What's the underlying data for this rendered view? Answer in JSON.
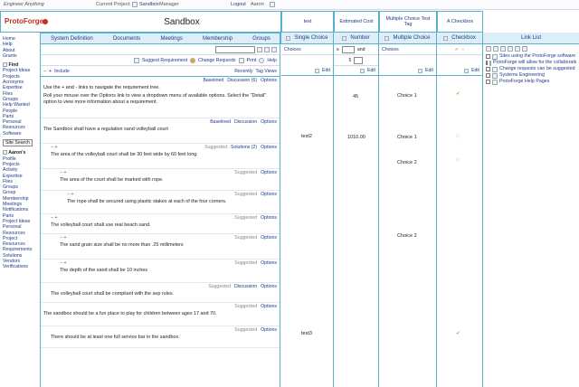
{
  "topbar": {
    "app": "Engineer Anything",
    "current_project_label": "Current Project:",
    "project_link": "Sandbox",
    "role": "Manager",
    "logout": "Logout",
    "user": "Aaron"
  },
  "logo": {
    "text": "ProtoForge"
  },
  "title": "Sandbox",
  "column_headers": {
    "text": "text",
    "estimated_cost": "Estimated Cost",
    "mc_tag": "Multiple Choice Test Tag",
    "checkbox": "A Checkbox"
  },
  "tabs": [
    "System Definition",
    "Documents",
    "Meetings",
    "Membership",
    "Groups"
  ],
  "sidebar": {
    "top_links": [
      "Home",
      "Help",
      "About",
      "Grants"
    ],
    "find_title": "Find",
    "find_links": [
      "Project Ideas",
      "Projects",
      "Acronyms",
      "Expertise",
      "Files",
      "Groups",
      "Help Wanted",
      "People",
      "Parts",
      "Personal",
      "Resources",
      "Software"
    ],
    "site_search": "Site Search",
    "user_title": "Aaron's",
    "user_links": [
      "Profile",
      "Projects",
      "Activity",
      "Expertise",
      "Files",
      "Groups",
      "Group Membership",
      "Meetings",
      "Notifications",
      "Parts",
      "Project Ideas",
      "Personal Resources",
      "Project Resources",
      "Requirements",
      "Solutions",
      "Vendors",
      "Verifications"
    ]
  },
  "main_controls": {
    "suggest": "Suggest Requirement",
    "change": "Change Requests",
    "print": "Print",
    "help": "Help",
    "include": "Include",
    "recently": "Recently",
    "tag_views": "Tag Views"
  },
  "intro": {
    "baselined": "Baselined",
    "discussion": "Discussion (6)",
    "options": "Options",
    "line1": "Use the + and - links to navigate the requirement tree.",
    "line2": "Roll your mouse over the Options link to view a dropdown menu of available options. Select the \"Detail\" option to view more information about a requirement."
  },
  "requirements": [
    {
      "meta": [
        "Baselined",
        "Discussion",
        "Options"
      ],
      "text": "The Sandbox shall have a regulation sand volleyball court"
    },
    {
      "meta": [
        "Suggested",
        "Solutions (2)",
        "Options"
      ],
      "text": "The area of the volleyball court shall be 30 feet wide by 60 feet long."
    },
    {
      "meta": [
        "Suggested",
        "Options"
      ],
      "text": "The area of the court shall be marked with rope."
    },
    {
      "meta": [
        "Suggested",
        "Options"
      ],
      "text": "The rope shall be secured using plastic stakes at each of the four corners."
    },
    {
      "meta": [
        "Suggested",
        "Options"
      ],
      "text": "The volleyball court shall use real beach sand."
    },
    {
      "meta": [
        "Suggested",
        "Options"
      ],
      "text": "The sand grain size shall be no more than .25 millimeters"
    },
    {
      "meta": [
        "Suggested",
        "Options"
      ],
      "text": "The depth of the sand shall be 10 inches"
    },
    {
      "meta": [
        "Suggested",
        "Discussion",
        "Options"
      ],
      "text": "The volleyball court shall be compliant with the avp rules."
    },
    {
      "meta": [
        "Suggested",
        "Options"
      ],
      "text": "The sandbox should be a fun place to play for children between ages 17 and 70."
    },
    {
      "meta": [
        "Suggested",
        "Options"
      ],
      "text": "There should be at least one full service bar in the sandbox."
    }
  ],
  "col_single": {
    "title": "Single Choice",
    "choices": "Choices",
    "edit": "Edit",
    "values": [
      "test2",
      "test3"
    ]
  },
  "col_number": {
    "title": "Number",
    "and": "and",
    "five": "5",
    "edit": "Edit",
    "values": [
      "45",
      "1010.00"
    ]
  },
  "col_multi": {
    "title": "Multiple Choice",
    "choices": "Choices",
    "edit": "Edit",
    "values": [
      "Choice 1",
      "Choice 1",
      "Choice 2",
      "Choice 2"
    ]
  },
  "col_checkbox": {
    "title": "Checkbox",
    "edit": "Edit"
  },
  "link_list": {
    "title": "Link List",
    "items": [
      "Sites using the ProtoForge software",
      "ProtoForge will allow for the collaboration",
      "Change requests can be suggested",
      "Systems Engineering",
      "ProtoForge Help Pages"
    ]
  },
  "colors": {
    "border": "#5aaed0",
    "header_bg": "#dceef8",
    "link": "#1f3b8a",
    "logo": "#c03020"
  }
}
